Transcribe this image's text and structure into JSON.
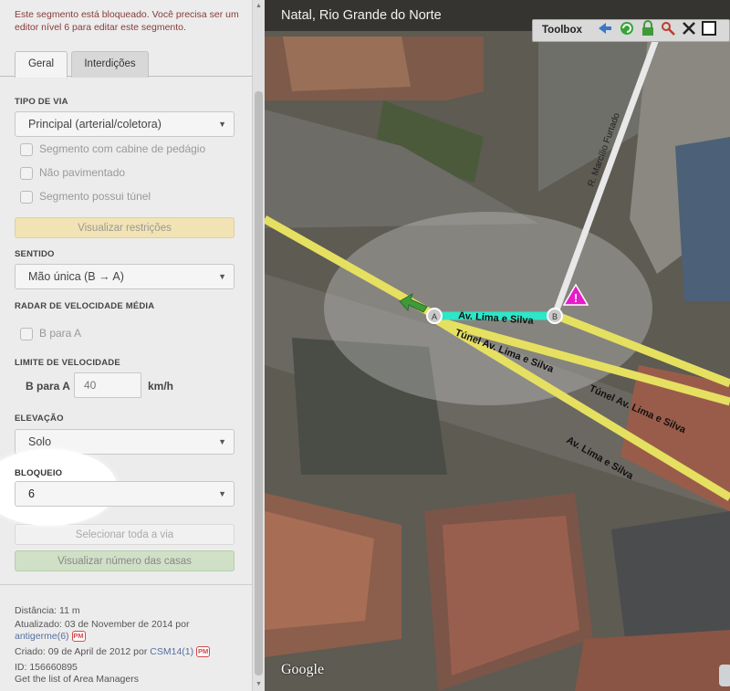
{
  "panel": {
    "lock_message": "Este segmento está bloqueado. Você precisa ser um editor nível 6 para editar este segmento.",
    "tabs": [
      {
        "label": "Geral",
        "active": true
      },
      {
        "label": "Interdições",
        "active": false
      }
    ],
    "road_type": {
      "title": "TIPO DE VIA",
      "value": "Principal (arterial/coletora)"
    },
    "checkboxes": [
      {
        "label": "Segmento com cabine de pedágio",
        "checked": false
      },
      {
        "label": "Não pavimentado",
        "checked": false
      },
      {
        "label": "Segmento possui túnel",
        "checked": false
      }
    ],
    "restrictions_button": "Visualizar restrições",
    "direction": {
      "title": "SENTIDO",
      "value": "Mão única (B → A)"
    },
    "average_speed_radar": {
      "title": "RADAR DE VELOCIDADE MÉDIA",
      "checkbox_label": "B para A"
    },
    "speed_limit": {
      "title": "LIMITE DE VELOCIDADE",
      "direction": "B para A",
      "value": "40",
      "unit": "km/h"
    },
    "elevation": {
      "title": "ELEVAÇÃO",
      "value": "Solo"
    },
    "lock": {
      "title": "BLOQUEIO",
      "value": "6"
    },
    "select_road_button": "Selecionar toda a via",
    "house_numbers_button": "Visualizar número das casas",
    "footer": {
      "distance": "Distância: 11 m",
      "updated": "Atualizado: 03 de November de 2014 por",
      "updated_by": "antigerme(6)",
      "created": "Criado: 09 de April de 2012 por",
      "created_by": "CSM14(1)",
      "pm_badge": "PM",
      "id": "ID: 156660895",
      "area_managers_link": "Get the list of Area Managers"
    }
  },
  "map": {
    "title": "Natal, Rio Grande do Norte",
    "toolbox_label": "Toolbox",
    "toolbox_icons": [
      "back-arrow-icon",
      "refresh-icon",
      "lock-icon",
      "user-search-icon",
      "tools-icon",
      "window-icon"
    ],
    "street_labels": {
      "r_marcilio": "R. Marcílio Furtado",
      "av_lima_top": "Av. Lima e Silva",
      "tunnel_1": "Túnel Av. Lima e Silva",
      "tunnel_2": "Túnel Av. Lima e Silva",
      "av_lima_bottom": "Av. Lima e Silva"
    },
    "node_a": "A",
    "node_b": "B",
    "attribution": "Google",
    "colors": {
      "road_yellow": "#e6e061",
      "selected_segment": "#2ee6c8",
      "street_white": "#e8e8e8",
      "warning_magenta": "#e81ac9",
      "arrow_green": "#3f9a3a"
    }
  }
}
